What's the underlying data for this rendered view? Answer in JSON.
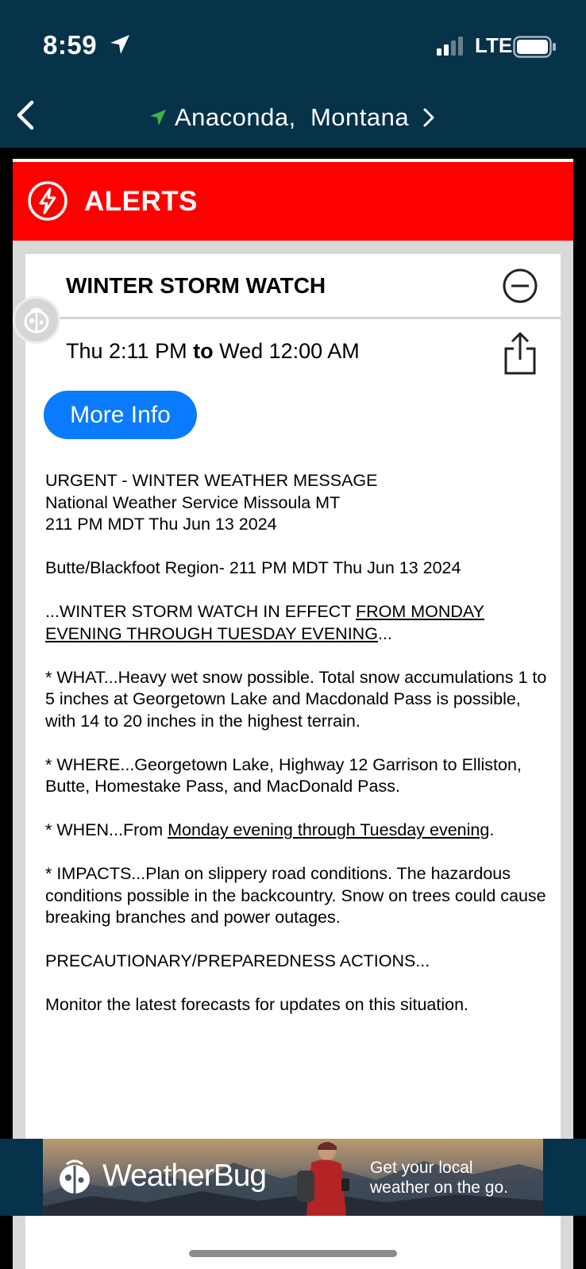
{
  "status_bar": {
    "time": "8:59",
    "network": "LTE"
  },
  "nav": {
    "location": "Anaconda,  Montana"
  },
  "alerts": {
    "title": "ALERTS"
  },
  "alert": {
    "title": "WINTER STORM WATCH",
    "start": "Thu 2:11 PM",
    "to": "to",
    "end": "Wed 12:00 AM",
    "more_info": "More Info",
    "header_lines": [
      "URGENT - WINTER WEATHER MESSAGE",
      "National Weather Service Missoula MT",
      "211 PM MDT Thu Jun 13 2024"
    ],
    "region": "Butte/Blackfoot Region- 211 PM MDT Thu Jun 13 2024",
    "effect_prefix": "...WINTER STORM WATCH IN EFFECT ",
    "effect_link": "FROM MONDAY EVENING THROUGH TUESDAY EVENING",
    "effect_suffix": "...",
    "what": "* WHAT...Heavy wet snow possible. Total snow accumulations 1 to 5 inches at Georgetown Lake and Macdonald Pass is possible, with 14 to 20 inches in the highest terrain.",
    "where": "* WHERE...Georgetown Lake, Highway 12 Garrison to Elliston, Butte, Homestake Pass, and MacDonald Pass.",
    "when_prefix": "* WHEN...From ",
    "when_link": "Monday evening through Tuesday evening",
    "when_suffix": ".",
    "impacts": "* IMPACTS...Plan on slippery road conditions. The hazardous conditions possible in the backcountry. Snow on trees could cause breaking branches and power outages.",
    "precaution_heading": "PRECAUTIONARY/PREPAREDNESS ACTIONS...",
    "monitor": "Monitor the latest forecasts for updates on this situation."
  },
  "ad": {
    "brand": "WeatherBug",
    "tagline_1": "Get your local",
    "tagline_2": "weather on the go."
  },
  "colors": {
    "nav_bg": "#06324a",
    "alert_red": "#ff0000",
    "button_blue": "#0a7aff"
  },
  "icons": [
    "location-arrow-icon",
    "signal-icon",
    "battery-icon",
    "back-chevron-icon",
    "location-pin-icon",
    "forward-chevron-icon",
    "lightning-icon",
    "collapse-icon",
    "weatherbug-badge-icon",
    "share-icon"
  ]
}
